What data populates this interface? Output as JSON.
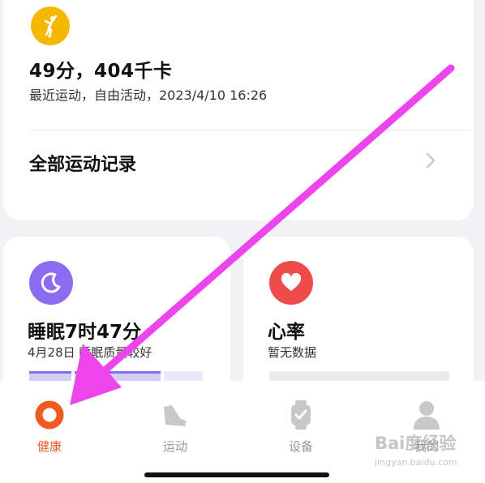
{
  "activity": {
    "title": "49分，404千卡",
    "subtitle": "最近运动，自由活动，2023/4/10 16:26",
    "all_records_label": "全部运动记录",
    "icon": "person-exercise-icon",
    "icon_color": "#f5b800"
  },
  "sleep": {
    "title": "睡眠7时47分",
    "subtitle": "4月28日 睡眠质量较好",
    "icon": "moon-icon",
    "icon_color": "#8b6cf0"
  },
  "heart_rate": {
    "title": "心率",
    "subtitle": "暂无数据",
    "icon": "heart-icon",
    "icon_color": "#ef4b4b"
  },
  "tabs": [
    {
      "label": "健康",
      "icon": "health-ring-icon",
      "active": true
    },
    {
      "label": "运动",
      "icon": "shoe-icon",
      "active": false
    },
    {
      "label": "设备",
      "icon": "watch-icon",
      "active": false
    },
    {
      "label": "我的",
      "icon": "user-icon",
      "active": false
    }
  ],
  "watermark": {
    "line1": "Bai度经验",
    "line2": "jingyan.baidu.com"
  },
  "colors": {
    "accent": "#f05a22",
    "arrow": "#ee44ee",
    "tab_inactive": "#999999"
  }
}
